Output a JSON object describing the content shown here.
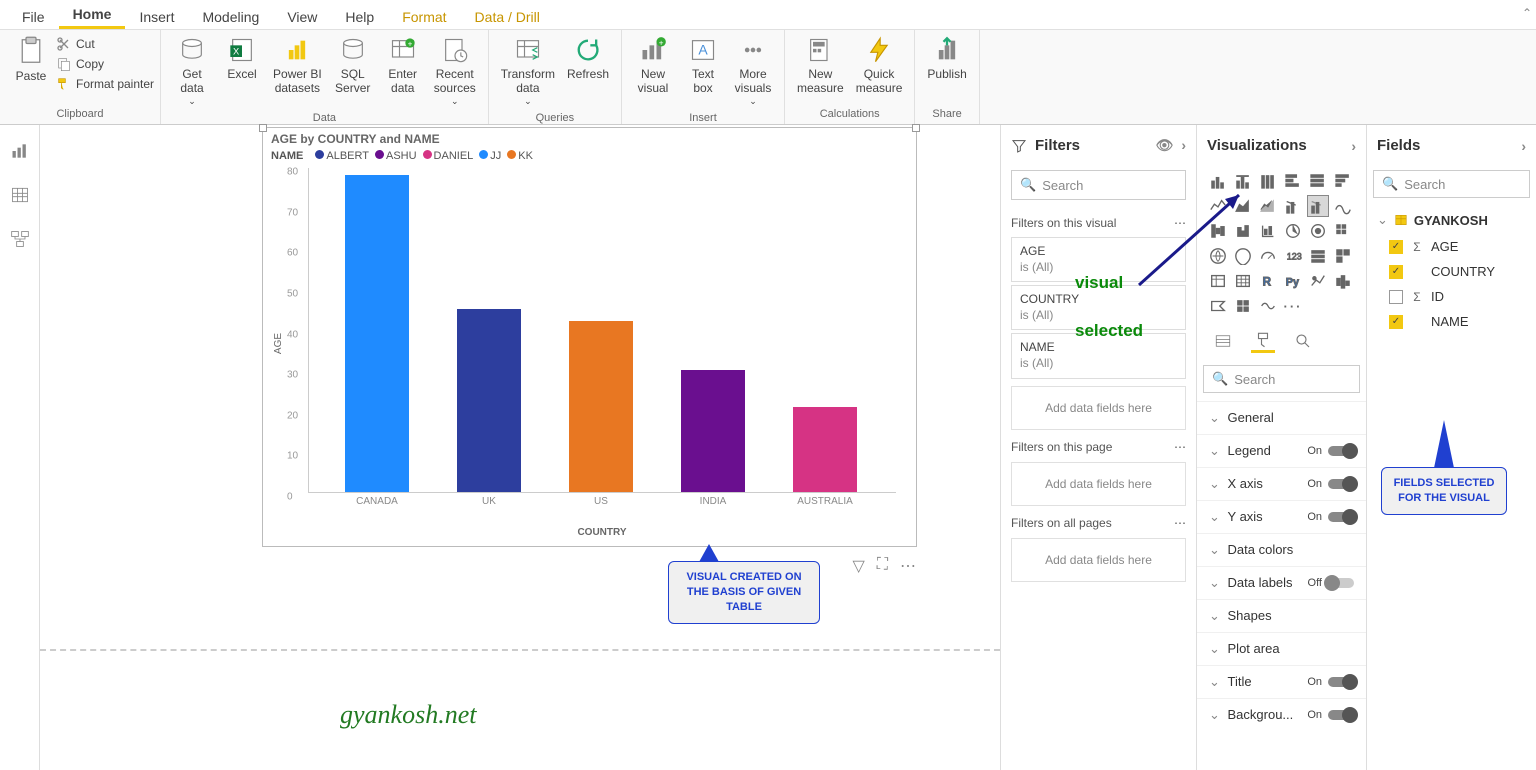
{
  "tabs": [
    "File",
    "Home",
    "Insert",
    "Modeling",
    "View",
    "Help",
    "Format",
    "Data / Drill"
  ],
  "ribbon": {
    "clipboard": {
      "paste": "Paste",
      "cut": "Cut",
      "copy": "Copy",
      "fmt": "Format painter",
      "label": "Clipboard"
    },
    "data": {
      "get": "Get\ndata",
      "excel": "Excel",
      "pbi": "Power BI\ndatasets",
      "sql": "SQL\nServer",
      "enter": "Enter\ndata",
      "recent": "Recent\nsources",
      "label": "Data"
    },
    "queries": {
      "trans": "Transform\ndata",
      "refresh": "Refresh",
      "label": "Queries"
    },
    "insert": {
      "newv": "New\nvisual",
      "text": "Text\nbox",
      "more": "More\nvisuals",
      "label": "Insert"
    },
    "calc": {
      "newm": "New\nmeasure",
      "quick": "Quick\nmeasure",
      "label": "Calculations"
    },
    "share": {
      "pub": "Publish",
      "label": "Share"
    }
  },
  "chart_data": {
    "type": "bar",
    "title": "AGE by COUNTRY and NAME",
    "legend_title": "NAME",
    "series_colors": {
      "ALBERT": "#2d3e9e",
      "ASHU": "#6a0f8f",
      "DANIEL": "#d63384",
      "JJ": "#1f8bff",
      "KK": "#e87722"
    },
    "categories": [
      "CANADA",
      "UK",
      "US",
      "INDIA",
      "AUSTRALIA"
    ],
    "values": [
      78,
      45,
      42,
      30,
      21
    ],
    "bar_colors": [
      "#1f8bff",
      "#2d3e9e",
      "#e87722",
      "#6a0f8f",
      "#d63384"
    ],
    "ylabel": "AGE",
    "xlabel": "COUNTRY",
    "ylim": [
      0,
      80
    ],
    "yticks": [
      0,
      10,
      20,
      30,
      40,
      50,
      60,
      70,
      80
    ]
  },
  "callouts": {
    "c1": "VISUAL CREATED ON THE BASIS OF GIVEN TABLE",
    "green1": "visual",
    "green2": "selected",
    "c2": "FIELDS SELECTED FOR THE VISUAL"
  },
  "watermark": "gyankosh.net",
  "filters": {
    "title": "Filters",
    "search": "Search",
    "sect1": "Filters on this visual",
    "items": [
      {
        "name": "AGE",
        "cond": "is (All)"
      },
      {
        "name": "COUNTRY",
        "cond": "is (All)"
      },
      {
        "name": "NAME",
        "cond": "is (All)"
      }
    ],
    "add": "Add data fields here",
    "sect2": "Filters on this page",
    "sect3": "Filters on all pages"
  },
  "viz": {
    "title": "Visualizations",
    "search": "Search",
    "props": [
      {
        "name": "General",
        "toggle": null
      },
      {
        "name": "Legend",
        "toggle": "On"
      },
      {
        "name": "X axis",
        "toggle": "On"
      },
      {
        "name": "Y axis",
        "toggle": "On"
      },
      {
        "name": "Data colors",
        "toggle": null
      },
      {
        "name": "Data labels",
        "toggle": "Off"
      },
      {
        "name": "Shapes",
        "toggle": null
      },
      {
        "name": "Plot area",
        "toggle": null
      },
      {
        "name": "Title",
        "toggle": "On"
      },
      {
        "name": "Backgrou...",
        "toggle": "On"
      }
    ]
  },
  "fields": {
    "title": "Fields",
    "search": "Search",
    "table": "GYANKOSH",
    "items": [
      {
        "name": "AGE",
        "checked": true,
        "sigma": true
      },
      {
        "name": "COUNTRY",
        "checked": true,
        "sigma": false
      },
      {
        "name": "ID",
        "checked": false,
        "sigma": true
      },
      {
        "name": "NAME",
        "checked": true,
        "sigma": false
      }
    ]
  }
}
